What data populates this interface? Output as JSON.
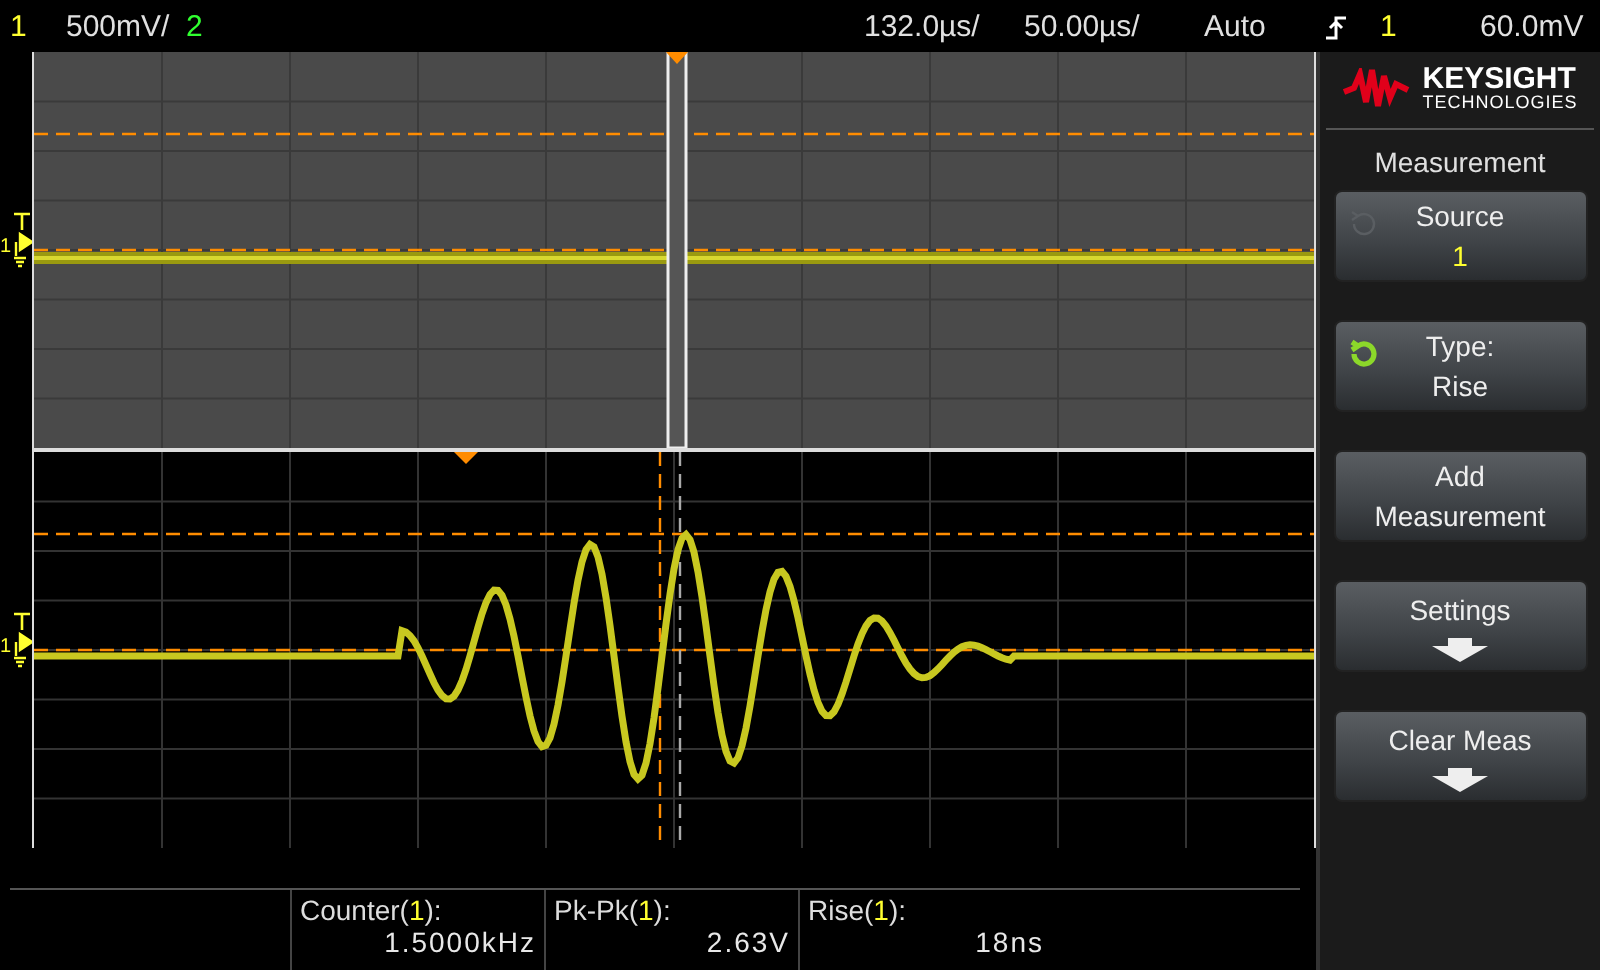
{
  "top_bar": {
    "ch1_label": "1",
    "ch1_scale": "500mV/",
    "ch2_label": "2",
    "delay": "132.0µs/",
    "timebase": "50.00µs/",
    "trigger_mode": "Auto",
    "trigger_source": "1",
    "trigger_level": "60.0mV"
  },
  "scope": {
    "upper_channel_marker": "1",
    "lower_channel_marker": "1"
  },
  "measurements": [
    {
      "name": "Counter(",
      "source": "1",
      "close": "):",
      "value": "1.5000kHz"
    },
    {
      "name": "Pk-Pk(",
      "source": "1",
      "close": "):",
      "value": "2.63V"
    },
    {
      "name": "Rise(",
      "source": "1",
      "close": "):",
      "value": "18ns"
    }
  ],
  "brand": {
    "name": "KEYSIGHT",
    "tagline": "TECHNOLOGIES"
  },
  "panel_title": "Measurement",
  "softkeys": [
    {
      "kind": "value",
      "label": "Source",
      "value": "1",
      "knob_active": false
    },
    {
      "kind": "value",
      "label": "Type:",
      "value": "Rise",
      "knob_active": true
    },
    {
      "kind": "plain",
      "label": "Add Measurement"
    },
    {
      "kind": "submenu",
      "label": "Settings"
    },
    {
      "kind": "submenu",
      "label": "Clear Meas"
    }
  ]
}
